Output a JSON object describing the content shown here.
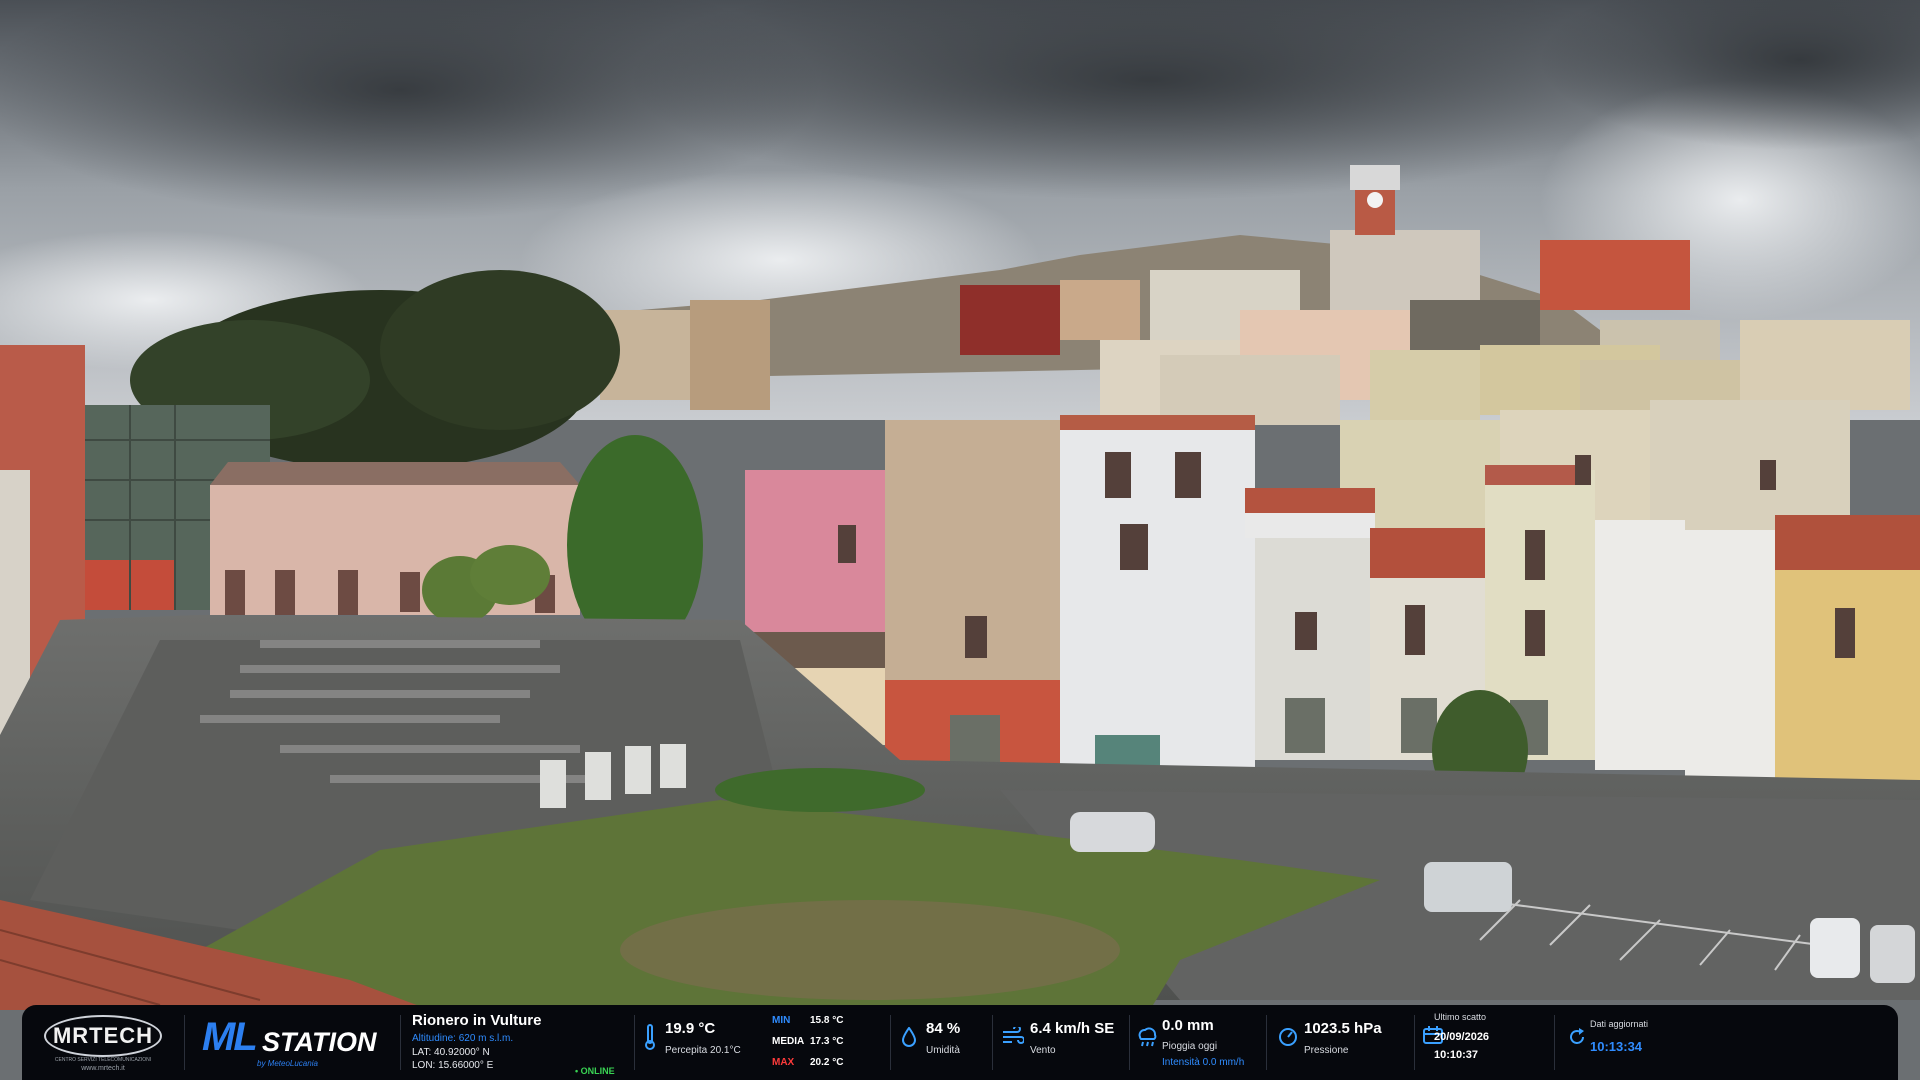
{
  "branding": {
    "mrtech_logo": "MRTECH",
    "mrtech_subtitle": "CENTRO SERVIZI TELECOMUNICAZIONI",
    "mrtech_url": "www.mrtech.it",
    "mlstation_logo_ml": "ML",
    "mlstation_logo_station": "STATION",
    "mlstation_by": "by MeteoLucania"
  },
  "location": {
    "name": "Rionero in Vulture",
    "altitude": "Altitudine: 620 m s.l.m.",
    "lat": "LAT: 40.92000° N",
    "lon": "LON: 15.66000° E",
    "status": "• ONLINE"
  },
  "temperature": {
    "icon": "thermometer-icon",
    "value": "19.9 °C",
    "feels_like": "Percepita 20.1°C",
    "min_label": "MIN",
    "min_value": "15.8 °C",
    "avg_label": "MEDIA",
    "avg_value": "17.3 °C",
    "max_label": "MAX",
    "max_value": "20.2 °C"
  },
  "humidity": {
    "icon": "droplet-icon",
    "value": "84 %",
    "label": "Umidità"
  },
  "wind": {
    "icon": "wind-icon",
    "value": "6.4 km/h SE",
    "label": "Vento"
  },
  "rain": {
    "icon": "rain-cloud-icon",
    "value": "0.0 mm",
    "label": "Pioggia oggi",
    "intensity": "Intensità 0.0 mm/h"
  },
  "pressure": {
    "icon": "gauge-icon",
    "value": "1023.5 hPa",
    "label": "Pressione"
  },
  "last_shot": {
    "icon": "camera-icon",
    "label": "Ultimo scatto",
    "date": "20/09/2026",
    "time": "10:10:37"
  },
  "updated": {
    "icon": "refresh-icon",
    "label": "Dati aggiornati",
    "time": "10:13:34"
  },
  "colors": {
    "bar_bg": "#06080d",
    "accent_blue": "#2f8cff",
    "online_green": "#39d353",
    "min_color": "#2f8cff",
    "avg_color": "#ffffff",
    "max_color": "#ff3b3b"
  }
}
